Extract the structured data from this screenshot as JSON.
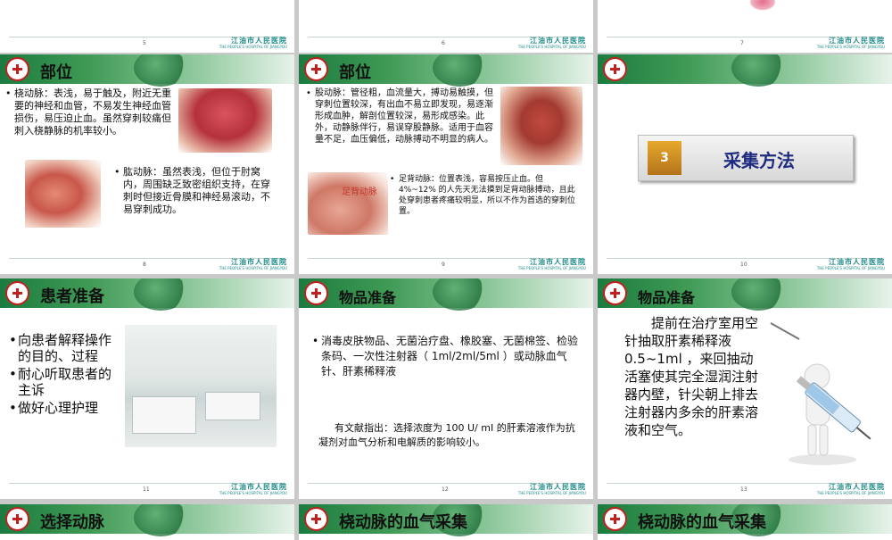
{
  "footer": {
    "hospital_cn": "江油市人民医院",
    "hospital_en": "THE PEOPLE'S HOSPITAL OF JIANGYOU"
  },
  "row0": {
    "pages": [
      "5",
      "6",
      "7"
    ]
  },
  "slide8": {
    "title": "部位",
    "radial": "桡动脉：表浅，易于触及，附近无重要的神经和血管，不易发生神经血管损伤，易压迫止血。虽然穿刺较痛但刺入桡静脉的机率较小。",
    "brachial": "肱动脉：虽然表浅，但位于肘窝内，周围缺乏致密组织支持，在穿刺时但接近骨膜和神经易滚动，不易穿刺成功。",
    "page": "8"
  },
  "slide9": {
    "title": "部位",
    "femoral": "股动脉：管径粗，血流量大，搏动易触摸，但穿刺位置较深，有出血不易立即发现，易逐渐形成血肿，解剖位置较深，易形成感染。此外，动静脉伴行，易误穿股静脉。适用于血容量不足，血压偏低，动脉搏动不明显的病人。",
    "foot_label": "足背动脉",
    "dorsalis": "足背动脉：位置表浅，容易按压止血。但 4%~12% 的人先天无法摸到足背动脉搏动，且此处穿刺患者疼痛较明显，所以不作为首选的穿刺位置。",
    "page": "9"
  },
  "slide10": {
    "number": "3",
    "label": "采集方法",
    "page": "10"
  },
  "slide11": {
    "title": "患者准备",
    "items": [
      "向患者解释操作的目的、过程",
      "耐心听取患者的主诉",
      "做好心理护理"
    ],
    "page": "11"
  },
  "slide12": {
    "title": "物品准备",
    "item": "消毒皮肤物品、无菌治疗盘、橡胶塞、无菌棉签、检验条码、一次性注射器（ 1ml/2ml/5ml ）或动脉血气针、肝素稀释液",
    "note": "有文献指出：选择浓度为 100 U/ mI 的肝素溶液作为抗凝剂对血气分析和电解质的影响较小。",
    "page": "12"
  },
  "slide13": {
    "title": "物品准备",
    "body": "提前在治疗室用空针抽取肝素稀释液 0.5~1ml ，来回抽动活塞使其完全湿润注射器内壁，针尖朝上排去注射器内多余的肝素溶液和空气。",
    "page": "13"
  },
  "row3": {
    "titles": [
      "选择动脉",
      "桡动脉的血气采集",
      "桡动脉的血气采集"
    ]
  }
}
